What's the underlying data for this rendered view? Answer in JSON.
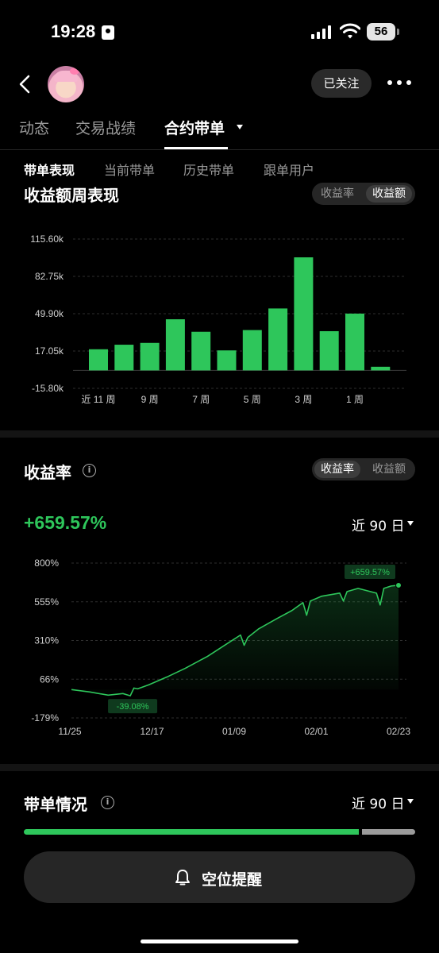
{
  "status_bar": {
    "time": "19:28",
    "battery": "56"
  },
  "header": {
    "follow_label": "已关注"
  },
  "tabs": [
    {
      "label": "动态"
    },
    {
      "label": "交易战绩"
    },
    {
      "label": "合约带单"
    }
  ],
  "subtabs": [
    {
      "label": "带单表现"
    },
    {
      "label": "当前带单"
    },
    {
      "label": "历史带单"
    },
    {
      "label": "跟单用户"
    }
  ],
  "weekly_section": {
    "title": "收益额周表现",
    "toggle": [
      "收益率",
      "收益额"
    ],
    "selected": "收益额"
  },
  "rate_section": {
    "title": "收益率",
    "toggle": [
      "收益率",
      "收益额"
    ],
    "selected": "收益率",
    "value": "+659.57%",
    "range": "近 90 日"
  },
  "order_section": {
    "title": "带单情况",
    "range": "近 90 日",
    "progress_fraction": 0.86
  },
  "alert_button": {
    "label": "空位提醒"
  },
  "colors": {
    "accent": "#2ec65b",
    "background": "#000000",
    "surface": "#262626"
  },
  "chart_data": [
    {
      "type": "bar",
      "ytick_labels": [
        "115.60k",
        "82.75k",
        "49.90k",
        "17.05k",
        "-15.80k"
      ],
      "ylim": [
        -15800,
        115600
      ],
      "xtick_labels": [
        "近 11 周",
        "9 周",
        "7 周",
        "5 周",
        "3 周",
        "1 周"
      ],
      "values": [
        18600,
        22600,
        24200,
        45000,
        34000,
        17600,
        35500,
        54500,
        99500,
        34500,
        50000,
        3200
      ],
      "grid": true
    },
    {
      "type": "area",
      "ytick_labels": [
        "800%",
        "555%",
        "310%",
        "66%",
        "-179%"
      ],
      "ylim": [
        -179,
        800
      ],
      "xtick_labels": [
        "11/25",
        "12/17",
        "01/09",
        "02/01",
        "02/23"
      ],
      "annotations": [
        "+659.57%",
        "-39.08%"
      ],
      "x": [
        0,
        5,
        10,
        14,
        16,
        17,
        18,
        21,
        26,
        31,
        37,
        43,
        46,
        47,
        48,
        51,
        56,
        60,
        63,
        64,
        65,
        68,
        73,
        74,
        75,
        78,
        83,
        84,
        85,
        87,
        89
      ],
      "y": [
        0,
        -15,
        -35,
        -25,
        -39.08,
        10,
        5,
        30,
        80,
        135,
        210,
        300,
        345,
        280,
        330,
        385,
        450,
        500,
        550,
        470,
        560,
        590,
        610,
        560,
        620,
        640,
        610,
        535,
        640,
        655,
        659.57
      ],
      "grid": true
    }
  ]
}
